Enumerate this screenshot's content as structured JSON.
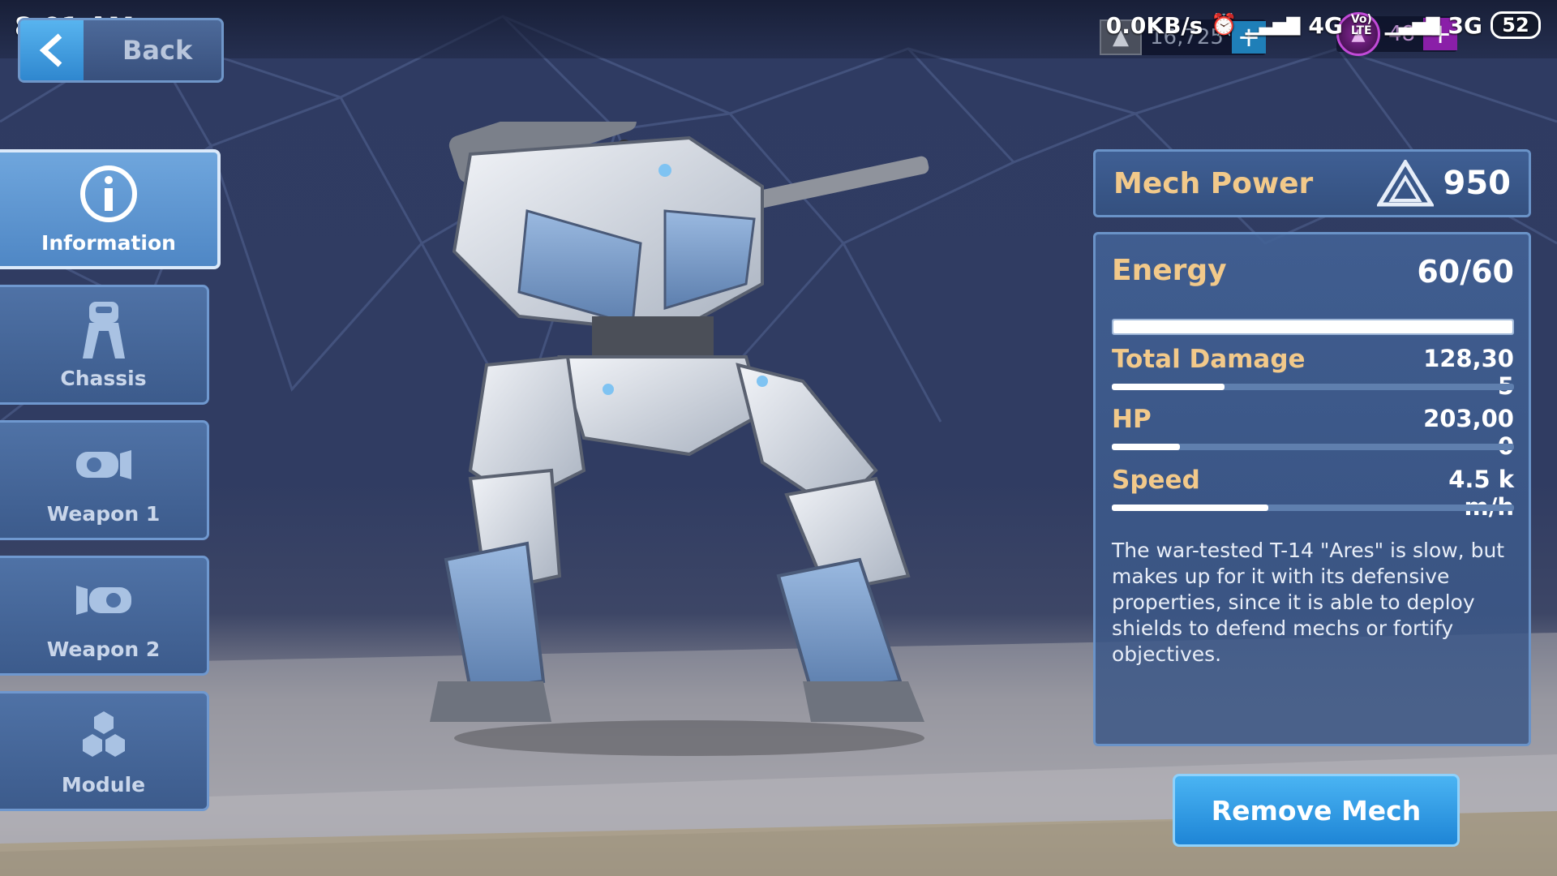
{
  "status_bar": {
    "time": "8:01 AM",
    "network_speed": "0.0KB/s",
    "signal_1": "4G",
    "volte": "Vo) LTE",
    "signal_2": "3G",
    "battery": "52"
  },
  "currencies": {
    "silver_value": "16,725",
    "gold_value": "48"
  },
  "back_button": {
    "label": "Back"
  },
  "side_tabs": [
    {
      "label": "Information",
      "icon": "info-icon",
      "active": true
    },
    {
      "label": "Chassis",
      "icon": "chassis-icon",
      "active": false
    },
    {
      "label": "Weapon 1",
      "icon": "weapon-icon",
      "active": false
    },
    {
      "label": "Weapon 2",
      "icon": "weapon-icon",
      "active": false
    },
    {
      "label": "Module",
      "icon": "module-icon",
      "active": false
    }
  ],
  "mech_power": {
    "label": "Mech Power",
    "value": "950"
  },
  "stats": {
    "energy": {
      "label": "Energy",
      "value": "60/60",
      "fraction": 1.0
    },
    "total_damage": {
      "label": "Total Damage",
      "value": "128,305",
      "fraction": 0.28
    },
    "hp": {
      "label": "HP",
      "value": "203,000",
      "fraction": 0.17
    },
    "speed": {
      "label": "Speed",
      "value": "4.5 km/h",
      "fraction": 0.39
    }
  },
  "description": "The war-tested T-14 \"Ares\" is slow, but makes up for it with its defensive properties, since it is able to deploy shields to defend mechs or fortify objectives.",
  "remove_button": {
    "label": "Remove Mech"
  },
  "colors": {
    "accent_gold": "#f2c98a",
    "panel_blue": "#3f5f94",
    "button_blue": "#2e9be6"
  }
}
